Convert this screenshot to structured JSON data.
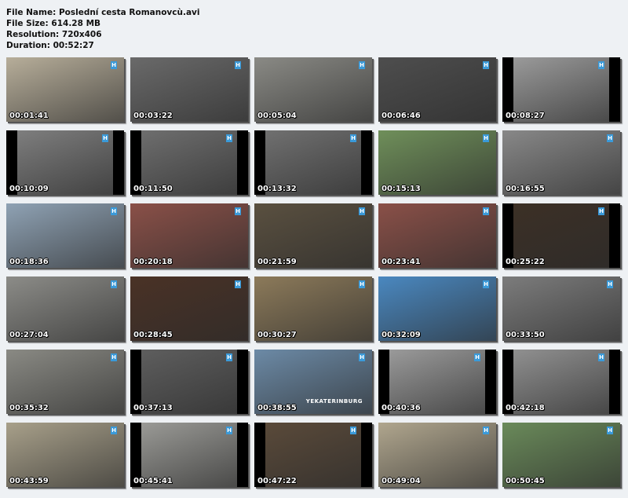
{
  "file_info": {
    "name": "File Name: Poslední cesta Romanovcù.avi",
    "size": "File Size: 614.28 MB",
    "resolution": "Resolution: 720x406",
    "duration": "Duration: 00:52:27"
  },
  "channel_logo": "H",
  "thumbnails": [
    {
      "time": "00:01:41",
      "bg": "#b7ae9a",
      "narrow": false
    },
    {
      "time": "00:03:22",
      "bg": "#6a6a6a",
      "narrow": false
    },
    {
      "time": "00:05:04",
      "bg": "#8a8a85",
      "narrow": false
    },
    {
      "time": "00:06:46",
      "bg": "#4e4e4e",
      "narrow": false
    },
    {
      "time": "00:08:27",
      "bg": "#9a9a9a",
      "narrow": true
    },
    {
      "time": "00:10:09",
      "bg": "#7e7e7e",
      "narrow": true
    },
    {
      "time": "00:11:50",
      "bg": "#6e6e6e",
      "narrow": true
    },
    {
      "time": "00:13:32",
      "bg": "#707070",
      "narrow": true
    },
    {
      "time": "00:15:13",
      "bg": "#6f8f5a",
      "narrow": false
    },
    {
      "time": "00:16:55",
      "bg": "#888888",
      "narrow": false
    },
    {
      "time": "00:18:36",
      "bg": "#8fa2b4",
      "narrow": false
    },
    {
      "time": "00:20:18",
      "bg": "#8a5048",
      "narrow": false
    },
    {
      "time": "00:21:59",
      "bg": "#5a5040",
      "narrow": false
    },
    {
      "time": "00:23:41",
      "bg": "#8a5048",
      "narrow": false
    },
    {
      "time": "00:25:22",
      "bg": "#3c3026",
      "narrow": true
    },
    {
      "time": "00:27:04",
      "bg": "#8c8c88",
      "narrow": false
    },
    {
      "time": "00:28:45",
      "bg": "#4a3226",
      "narrow": false
    },
    {
      "time": "00:30:27",
      "bg": "#8c7a5a",
      "narrow": false
    },
    {
      "time": "00:32:09",
      "bg": "#4a88c0",
      "narrow": false
    },
    {
      "time": "00:33:50",
      "bg": "#7c7c7c",
      "narrow": false
    },
    {
      "time": "00:35:32",
      "bg": "#8a8a84",
      "narrow": false
    },
    {
      "time": "00:37:13",
      "bg": "#5e5e5e",
      "narrow": true
    },
    {
      "time": "00:38:55",
      "bg": "#6c8aa6",
      "narrow": false,
      "caption": "YEKATERINBURG"
    },
    {
      "time": "00:40:36",
      "bg": "#9a9a9a",
      "narrow": true
    },
    {
      "time": "00:42:18",
      "bg": "#909090",
      "narrow": true
    },
    {
      "time": "00:43:59",
      "bg": "#a8a08a",
      "narrow": false
    },
    {
      "time": "00:45:41",
      "bg": "#9a9a96",
      "narrow": true
    },
    {
      "time": "00:47:22",
      "bg": "#5a4a3a",
      "narrow": true
    },
    {
      "time": "00:49:04",
      "bg": "#b0a68e",
      "narrow": false
    },
    {
      "time": "00:50:45",
      "bg": "#6a8a5a",
      "narrow": false
    }
  ]
}
